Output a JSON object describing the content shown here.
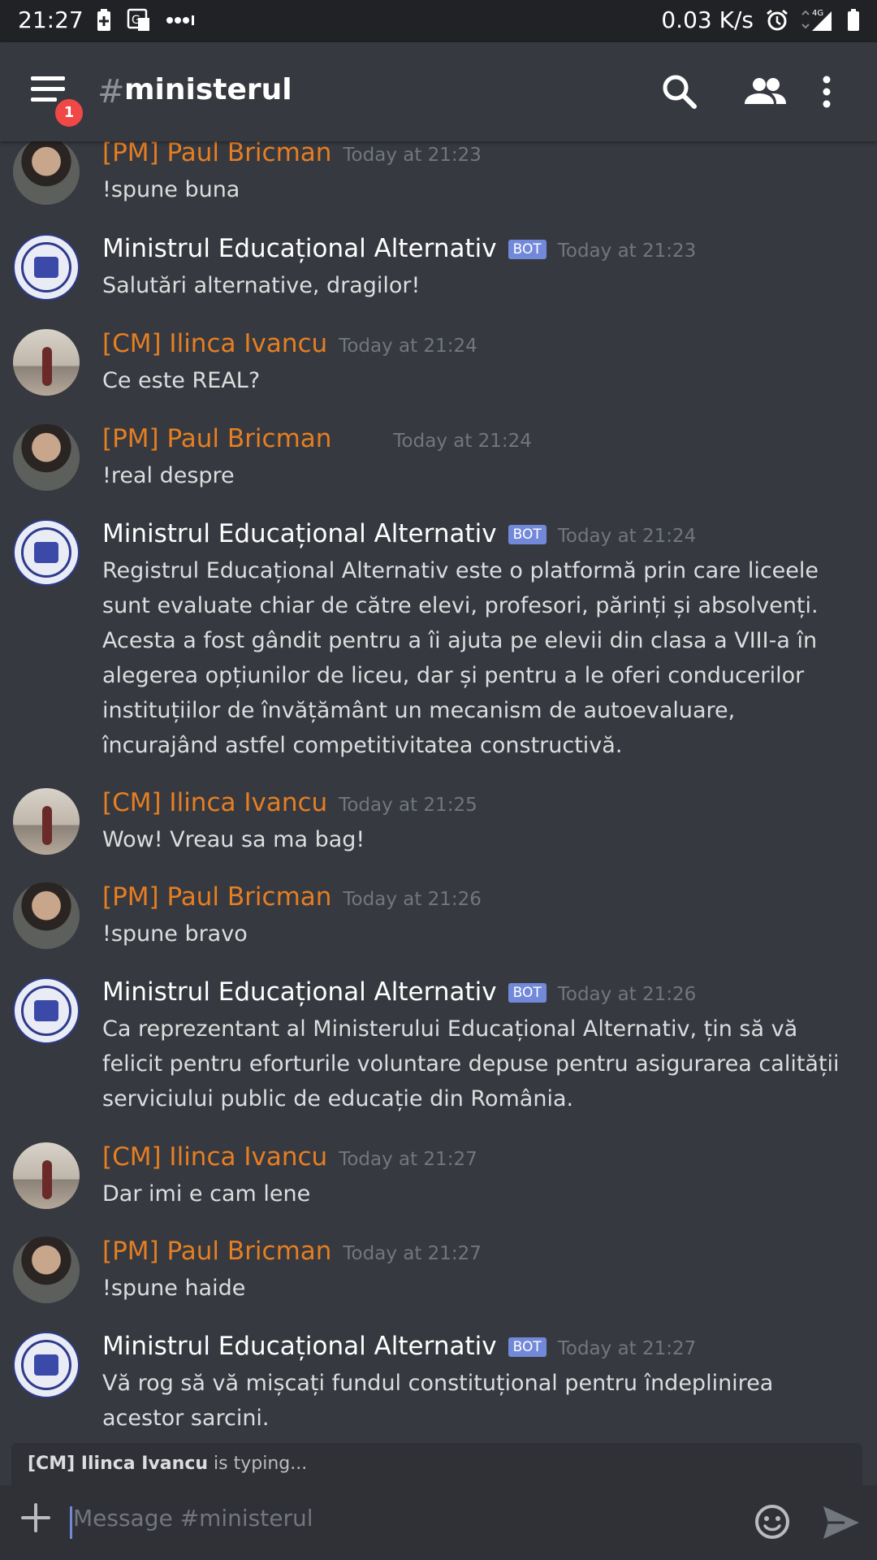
{
  "status_bar": {
    "time": "21:27",
    "speed": "0.03 K/s",
    "net": "4G"
  },
  "header": {
    "hash": "#",
    "channel": "ministerul",
    "badge": "1"
  },
  "messages": [
    {
      "author": "[PM] Paul Bricman",
      "type": "user",
      "avatar": "paul",
      "timestamp": "Today at 21:23",
      "text": "!spune buna"
    },
    {
      "author": "Ministrul Educațional Alternativ",
      "type": "bot",
      "avatar": "bot",
      "bot_tag": "BOT",
      "timestamp": "Today at 21:23",
      "text": "Salutări alternative, dragilor!"
    },
    {
      "author": "[CM] Ilinca Ivancu",
      "type": "user",
      "avatar": "ilinca",
      "timestamp": "Today at 21:24",
      "text": "Ce este REAL?"
    },
    {
      "author": "[PM] Paul Bricman",
      "type": "user",
      "avatar": "paul",
      "timestamp": "Today at 21:24",
      "text": "!real despre"
    },
    {
      "author": "Ministrul Educațional Alternativ",
      "type": "bot",
      "avatar": "bot",
      "bot_tag": "BOT",
      "timestamp": "Today at 21:24",
      "text": "Registrul Educațional Alternativ este o platformă prin care liceele sunt evaluate chiar de către elevi, profesori, părinți și absolvenți. Acesta a fost gândit pentru a îi ajuta pe elevii din clasa a VIII-a în alegerea opțiunilor de liceu, dar și pentru a le oferi conducerilor instituțiilor de învățământ un mecanism de autoevaluare, încurajând astfel competitivitatea constructivă."
    },
    {
      "author": "[CM] Ilinca Ivancu",
      "type": "user",
      "avatar": "ilinca",
      "timestamp": "Today at 21:25",
      "text": "Wow! Vreau sa ma bag!"
    },
    {
      "author": "[PM] Paul Bricman",
      "type": "user",
      "avatar": "paul",
      "timestamp": "Today at 21:26",
      "text": "!spune bravo"
    },
    {
      "author": "Ministrul Educațional Alternativ",
      "type": "bot",
      "avatar": "bot",
      "bot_tag": "BOT",
      "timestamp": "Today at 21:26",
      "text": "Ca reprezentant al Ministerului Educațional Alternativ, țin să vă felicit pentru eforturile voluntare depuse pentru asigurarea calității serviciului public de educație din România."
    },
    {
      "author": "[CM] Ilinca Ivancu",
      "type": "user",
      "avatar": "ilinca",
      "timestamp": "Today at 21:27",
      "text": "Dar imi e cam lene"
    },
    {
      "author": "[PM] Paul Bricman",
      "type": "user",
      "avatar": "paul",
      "timestamp": "Today at 21:27",
      "text": "!spune haide"
    },
    {
      "author": "Ministrul Educațional Alternativ",
      "type": "bot",
      "avatar": "bot",
      "bot_tag": "BOT",
      "timestamp": "Today at 21:27",
      "text": "Vă rog să vă mișcați fundul constituțional pentru îndeplinirea acestor sarcini."
    }
  ],
  "typing": {
    "user": "[CM] Ilinca Ivancu",
    "suffix": " is typing..."
  },
  "input": {
    "placeholder": "Message #ministerul"
  },
  "colors": {
    "background": "#36393f",
    "username": "#e67e22",
    "bot_tag": "#7289da",
    "badge": "#f04747"
  },
  "icons": [
    "menu-icon",
    "search-icon",
    "members-icon",
    "more-icon",
    "plus-icon",
    "emoji-icon",
    "send-icon"
  ]
}
